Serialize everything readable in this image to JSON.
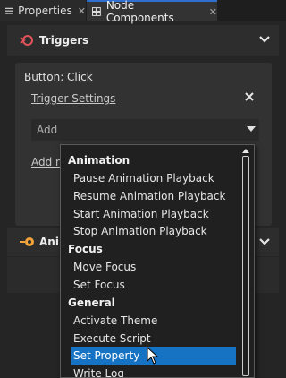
{
  "tabs": [
    {
      "label": "Properties",
      "close": "✕"
    },
    {
      "label": "Node Components",
      "close": "✕"
    }
  ],
  "triggers": {
    "title": "Triggers",
    "card_title": "Button: Click",
    "trigger_settings": "Trigger Settings",
    "add_placeholder": "Add",
    "add_new": "Add ne"
  },
  "animations": {
    "title": "Ani"
  },
  "dropdown": {
    "groups": [
      {
        "label": "Animation",
        "items": [
          "Pause Animation Playback",
          "Resume Animation Playback",
          "Start Animation Playback",
          "Stop Animation Playback"
        ]
      },
      {
        "label": "Focus",
        "items": [
          "Move Focus",
          "Set Focus"
        ]
      },
      {
        "label": "General",
        "items": [
          "Activate Theme",
          "Execute Script",
          "Set Property",
          "Write Log"
        ]
      }
    ],
    "selected": "Set Property"
  },
  "colors": {
    "accent": "#1673c4",
    "trigger_icon": "#e0535a",
    "anim_icon": "#f2a33a"
  }
}
